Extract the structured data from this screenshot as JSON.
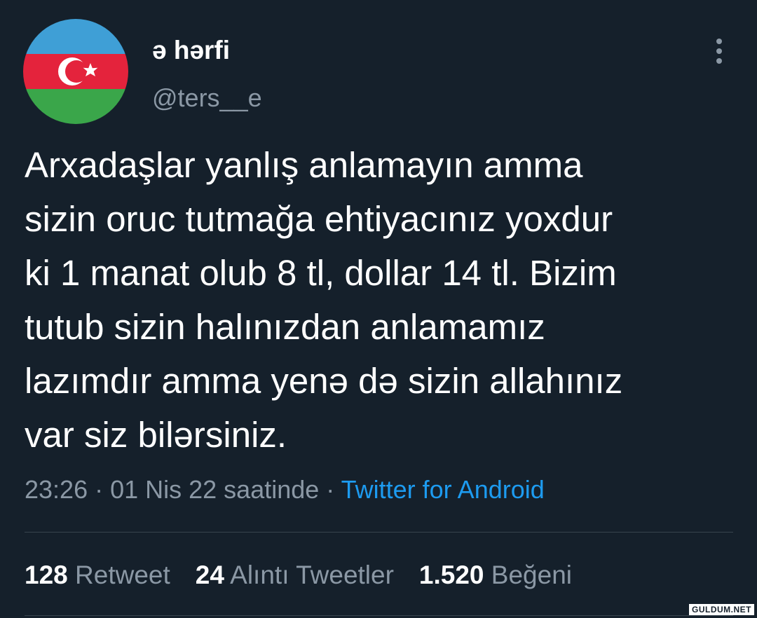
{
  "user": {
    "display_name": "ə hərfi",
    "handle": "@ters__e",
    "avatar": "azerbaijan-flag"
  },
  "header": {
    "more_icon": "more-vertical-icon"
  },
  "tweet": {
    "lines": [
      "Arxadaşlar yanlış anlamayın amma",
      "sizin oruc tutmağa ehtiyacınız yoxdur",
      "ki 1 manat olub 8 tl, dollar 14 tl. Bizim",
      "tutub sizin halınızdan anlamamız",
      "lazımdır amma yenə də sizin allahınız",
      "var siz bilərsiniz."
    ],
    "time": "23:26",
    "separator": " · ",
    "date": "01 Nis 22 saatinde",
    "source": "Twitter for Android"
  },
  "stats": {
    "retweets": {
      "count": "128",
      "label": "Retweet"
    },
    "quotes": {
      "count": "24",
      "label": "Alıntı Tweetler"
    },
    "likes": {
      "count": "1.520",
      "label": "Beğeni"
    }
  },
  "watermark": "GULDUM.NET",
  "colors": {
    "background": "#15202b",
    "text": "#ffffff",
    "secondary": "#8b98a5",
    "link": "#1d9bf0",
    "flag_blue": "#3f9fd6",
    "flag_red": "#e4233c",
    "flag_green": "#3aa64a"
  }
}
